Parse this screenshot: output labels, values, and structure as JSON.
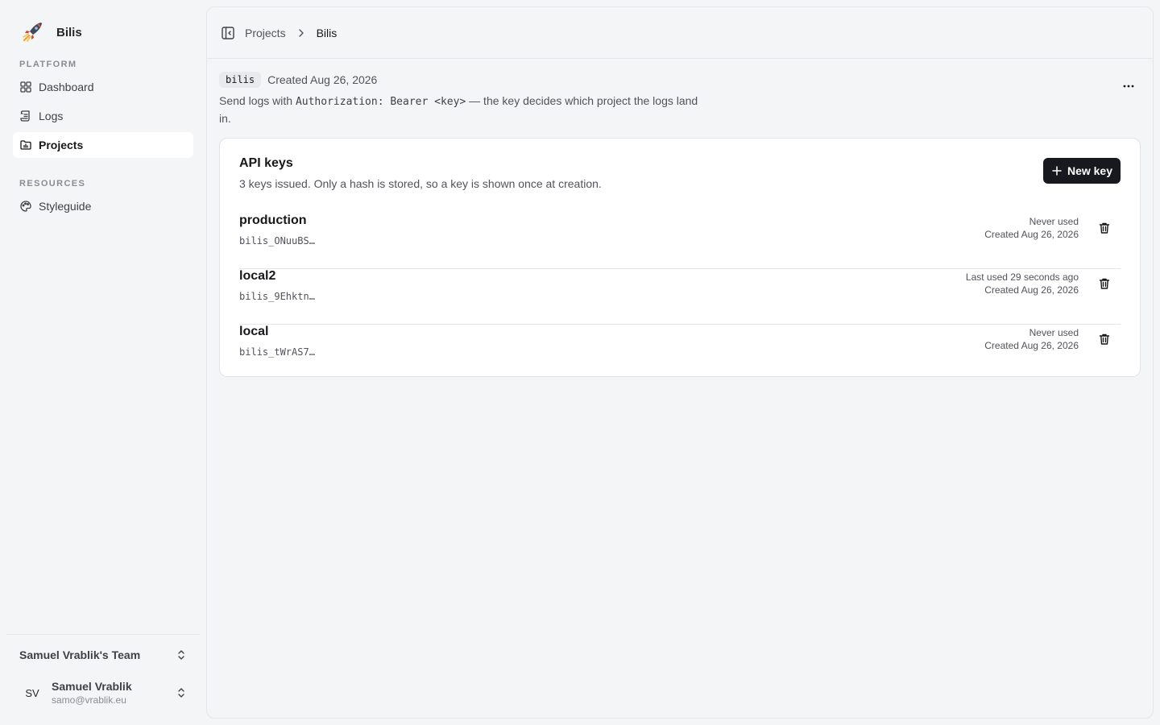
{
  "sidebar": {
    "brand": {
      "name": "Bilis",
      "icon": "rocket-logo"
    },
    "groups": [
      {
        "label": "PLATFORM",
        "items": [
          {
            "label": "Dashboard",
            "icon": "grid-icon",
            "active": false
          },
          {
            "label": "Logs",
            "icon": "scroll-icon",
            "active": false
          },
          {
            "label": "Projects",
            "icon": "folder-chart-icon",
            "active": true
          }
        ]
      },
      {
        "label": "RESOURCES",
        "items": [
          {
            "label": "Styleguide",
            "icon": "palette-icon",
            "active": false
          }
        ]
      }
    ],
    "team": {
      "name": "Samuel Vrablik's Team"
    },
    "user": {
      "initials": "SV",
      "name": "Samuel Vrablik",
      "email": "samo@vrablik.eu"
    }
  },
  "header": {
    "breadcrumb": [
      "Projects",
      "Bilis"
    ]
  },
  "project": {
    "slug": "bilis",
    "created": "Created Aug 26, 2026",
    "desc_prefix": "Send logs with ",
    "desc_code": "Authorization: Bearer <key>",
    "desc_suffix": " — the key decides which project the logs land in."
  },
  "api_keys": {
    "title": "API keys",
    "subtitle": "3 keys issued. Only a hash is stored, so a key is shown once at creation.",
    "new_button_label": "New key",
    "keys": [
      {
        "name": "production",
        "prefix": "bilis_ONuuBS…",
        "usage": "Never used",
        "created": "Created Aug 26, 2026"
      },
      {
        "name": "local2",
        "prefix": "bilis_9Ehktn…",
        "usage": "Last used 29 seconds ago",
        "created": "Created Aug 26, 2026"
      },
      {
        "name": "local",
        "prefix": "bilis_tWrAS7…",
        "usage": "Never used",
        "created": "Created Aug 26, 2026"
      }
    ]
  },
  "colors": {
    "background": "#f4f5f7",
    "card": "#ffffff",
    "primary_button": "#18181f",
    "text": "#18181b",
    "muted": "#52525b"
  }
}
